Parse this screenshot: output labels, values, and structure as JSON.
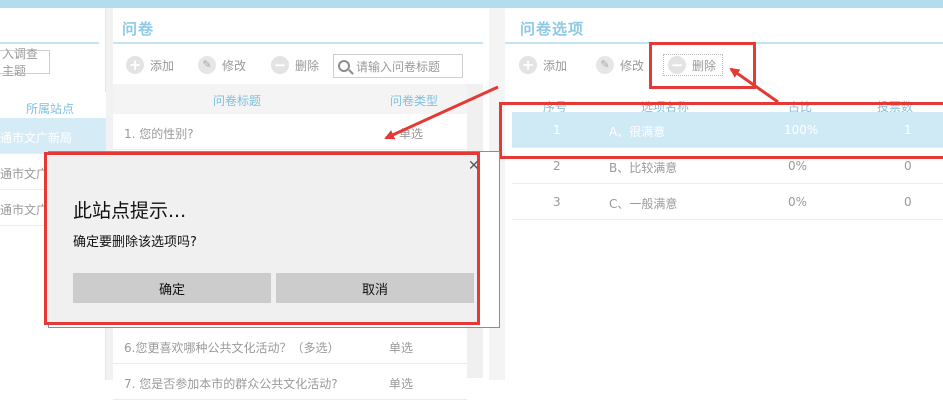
{
  "left_panel": {
    "search_placeholder": "入调查主题",
    "col_header": "所属站点",
    "rows": [
      "通市文广新局",
      "通市文广",
      "通市文广"
    ]
  },
  "mid_panel": {
    "title": "问卷",
    "toolbar": {
      "add": "添加",
      "edit": "修改",
      "delete": "删除",
      "search_placeholder": "请输入问卷标题"
    },
    "headers": {
      "title": "问卷标题",
      "type": "问卷类型"
    },
    "rows": [
      {
        "title": "1. 您的性别?",
        "type": "单选"
      },
      {
        "title": "6.您更喜欢哪种公共文化活动？（多选）",
        "type": "单选"
      },
      {
        "title": "7. 您是否参加本市的群众公共文化活动?",
        "type": "单选"
      }
    ]
  },
  "right_panel": {
    "title": "问卷选项",
    "toolbar": {
      "add": "添加",
      "edit": "修改",
      "delete": "删除"
    },
    "headers": {
      "index": "序号",
      "name": "选项名称",
      "ratio": "占比",
      "votes": "投票数"
    },
    "rows": [
      {
        "index": "1",
        "name": "A、很满意",
        "ratio": "100%",
        "votes": "1"
      },
      {
        "index": "2",
        "name": "B、比较满意",
        "ratio": "0%",
        "votes": "0"
      },
      {
        "index": "3",
        "name": "C、一般满意",
        "ratio": "0%",
        "votes": "0"
      }
    ]
  },
  "dialog": {
    "title": "此站点提示...",
    "message": "确定要删除该选项吗?",
    "ok": "确定",
    "cancel": "取消",
    "close_icon": "close-icon"
  },
  "colors": {
    "accent": "#8ec9e6",
    "highlight": "#e53935",
    "selected_row": "#cfe9f5"
  }
}
